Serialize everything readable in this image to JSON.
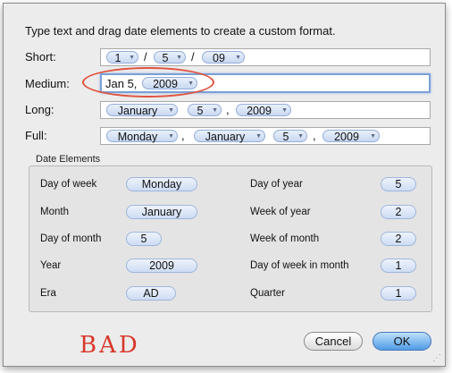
{
  "instruction": "Type text and drag date elements to create a custom format.",
  "formats": {
    "short": {
      "label": "Short:",
      "tokens": [
        "1",
        "5",
        "09"
      ],
      "separators": [
        "/",
        "/"
      ]
    },
    "medium": {
      "label": "Medium:",
      "prefix_text": "Jan 5,",
      "tokens": [
        "2009"
      ]
    },
    "long": {
      "label": "Long:",
      "tokens": [
        "January",
        "5",
        "2009"
      ],
      "separators": [
        "",
        ","
      ]
    },
    "full": {
      "label": "Full:",
      "tokens": [
        "Monday",
        "January",
        "5",
        "2009"
      ],
      "separators": [
        ",",
        "",
        ","
      ]
    }
  },
  "date_elements": {
    "title": "Date Elements",
    "left": [
      {
        "label": "Day of week",
        "value": "Monday"
      },
      {
        "label": "Month",
        "value": "January"
      },
      {
        "label": "Day of month",
        "value": "5"
      },
      {
        "label": "Year",
        "value": "2009"
      },
      {
        "label": "Era",
        "value": "AD"
      }
    ],
    "right": [
      {
        "label": "Day of year",
        "value": "5"
      },
      {
        "label": "Week of year",
        "value": "2"
      },
      {
        "label": "Week of month",
        "value": "2"
      },
      {
        "label": "Day of week in month",
        "value": "1"
      },
      {
        "label": "Quarter",
        "value": "1"
      }
    ]
  },
  "annotation": "BAD",
  "buttons": {
    "cancel": "Cancel",
    "ok": "OK"
  },
  "colors": {
    "annotation": "#d9372a",
    "highlight_oval": "#e0523c",
    "default_button": "#4f9be6"
  }
}
